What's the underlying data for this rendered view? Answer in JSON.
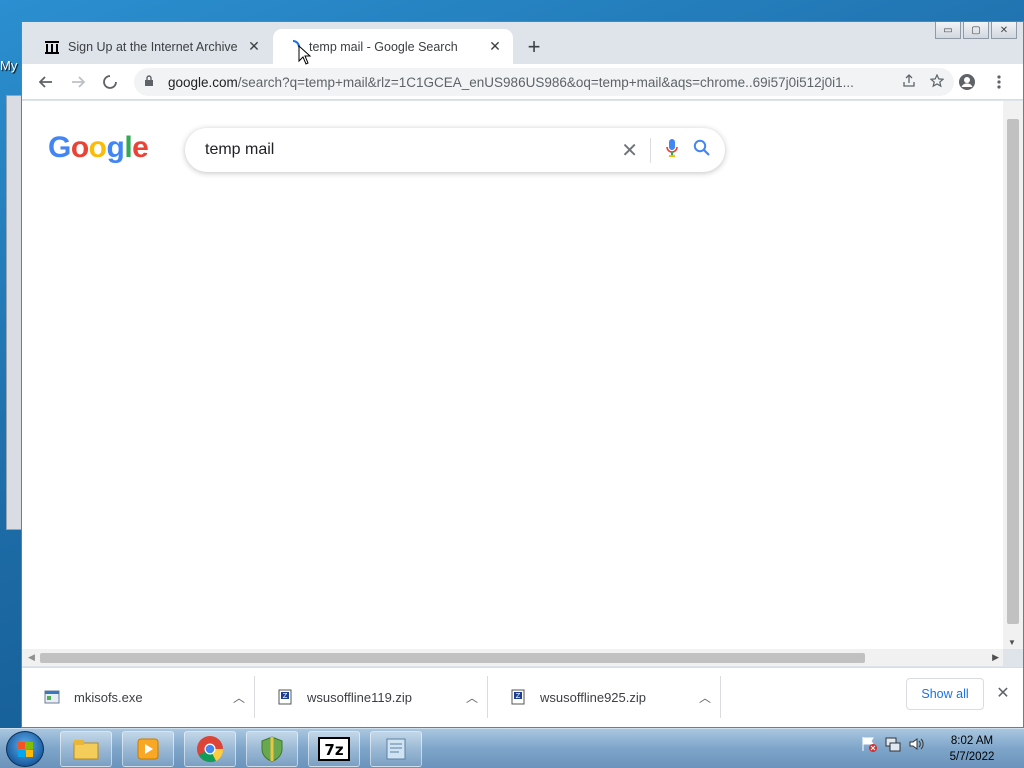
{
  "desktop": {
    "icon_label_fragment": "My"
  },
  "browser": {
    "tabs": [
      {
        "title": "Sign Up at the Internet Archive",
        "active": false
      },
      {
        "title": "temp mail - Google Search",
        "active": true
      }
    ],
    "new_tab_label": "+",
    "window_controls": {
      "minimize": "▭",
      "maximize": "▢",
      "close": "✕"
    },
    "toolbar": {
      "url_host": "google.com",
      "url_path": "/search?q=temp+mail&rlz=1C1GCEA_enUS986US986&oq=temp+mail&aqs=chrome..69i57j0i512j0i1...",
      "loading": true
    }
  },
  "page": {
    "logo": [
      "G",
      "o",
      "o",
      "g",
      "l",
      "e"
    ],
    "search_query": "temp mail"
  },
  "downloads": {
    "items": [
      {
        "name": "mkisofs.exe",
        "icon": "exe-file-icon"
      },
      {
        "name": "wsusoffline119.zip",
        "icon": "zip-file-icon"
      },
      {
        "name": "wsusoffline925.zip",
        "icon": "zip-file-icon"
      }
    ],
    "show_all_label": "Show all"
  },
  "taskbar": {
    "pinned": [
      "file-explorer-icon",
      "media-player-icon",
      "chrome-icon",
      "security-shield-icon",
      "7zip-icon",
      "notepad-icon"
    ],
    "seven_zip_label": "7z",
    "clock_time": "8:02 AM",
    "clock_date": "5/7/2022"
  },
  "colors": {
    "google_blue": "#4285f4",
    "google_red": "#ea4335",
    "google_yellow": "#fbbc05",
    "google_green": "#34a853",
    "link_blue": "#1a73e8"
  }
}
